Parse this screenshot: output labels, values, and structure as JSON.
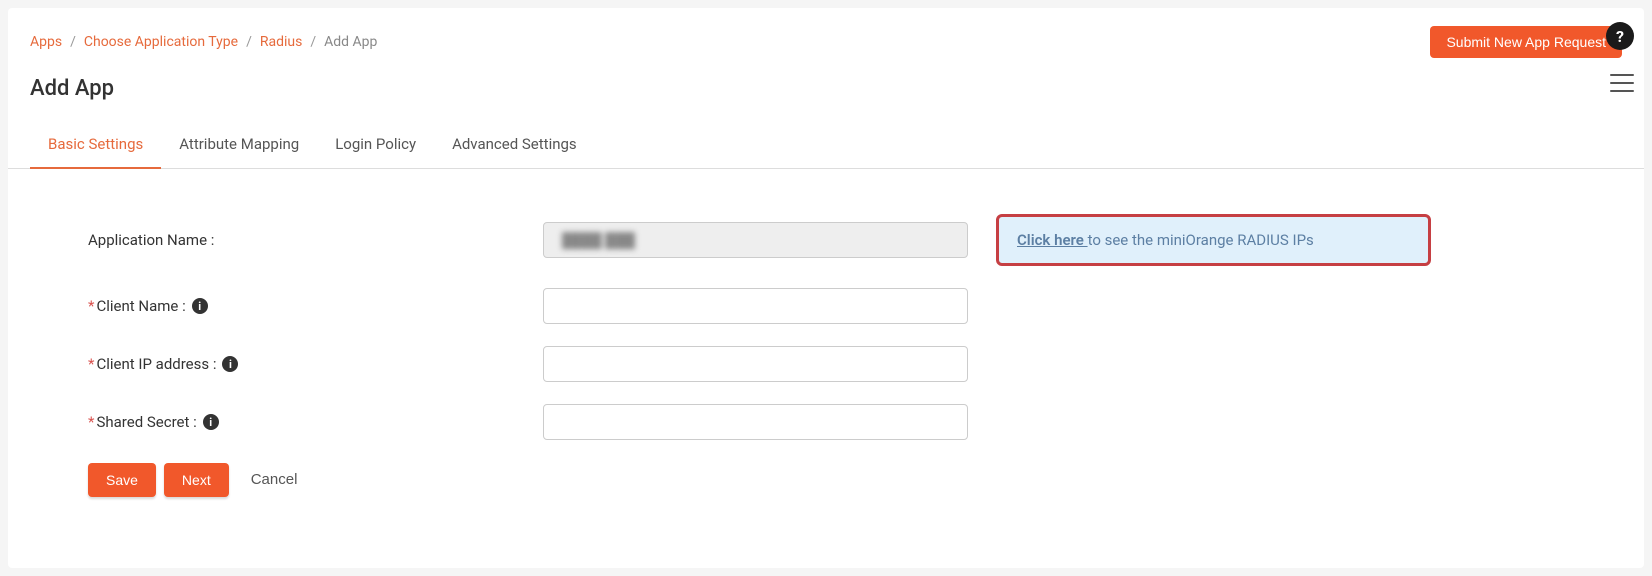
{
  "breadcrumb": {
    "items": [
      "Apps",
      "Choose Application Type",
      "Radius"
    ],
    "current": "Add App"
  },
  "header": {
    "submit_button": "Submit New App Request",
    "title": "Add App"
  },
  "tabs": [
    {
      "label": "Basic Settings",
      "active": true
    },
    {
      "label": "Attribute Mapping",
      "active": false
    },
    {
      "label": "Login Policy",
      "active": false
    },
    {
      "label": "Advanced Settings",
      "active": false
    }
  ],
  "form": {
    "app_name_label": "Application Name :",
    "app_name_value": "████ ███",
    "client_name_label": "Client Name :",
    "client_name_value": "",
    "client_ip_label": "Client IP address :",
    "client_ip_value": "",
    "shared_secret_label": "Shared Secret :",
    "shared_secret_value": ""
  },
  "callout": {
    "link_text": "Click here ",
    "rest_text": "to see the miniOrange RADIUS IPs"
  },
  "actions": {
    "save": "Save",
    "next": "Next",
    "cancel": "Cancel"
  },
  "float": {
    "help": "?"
  }
}
